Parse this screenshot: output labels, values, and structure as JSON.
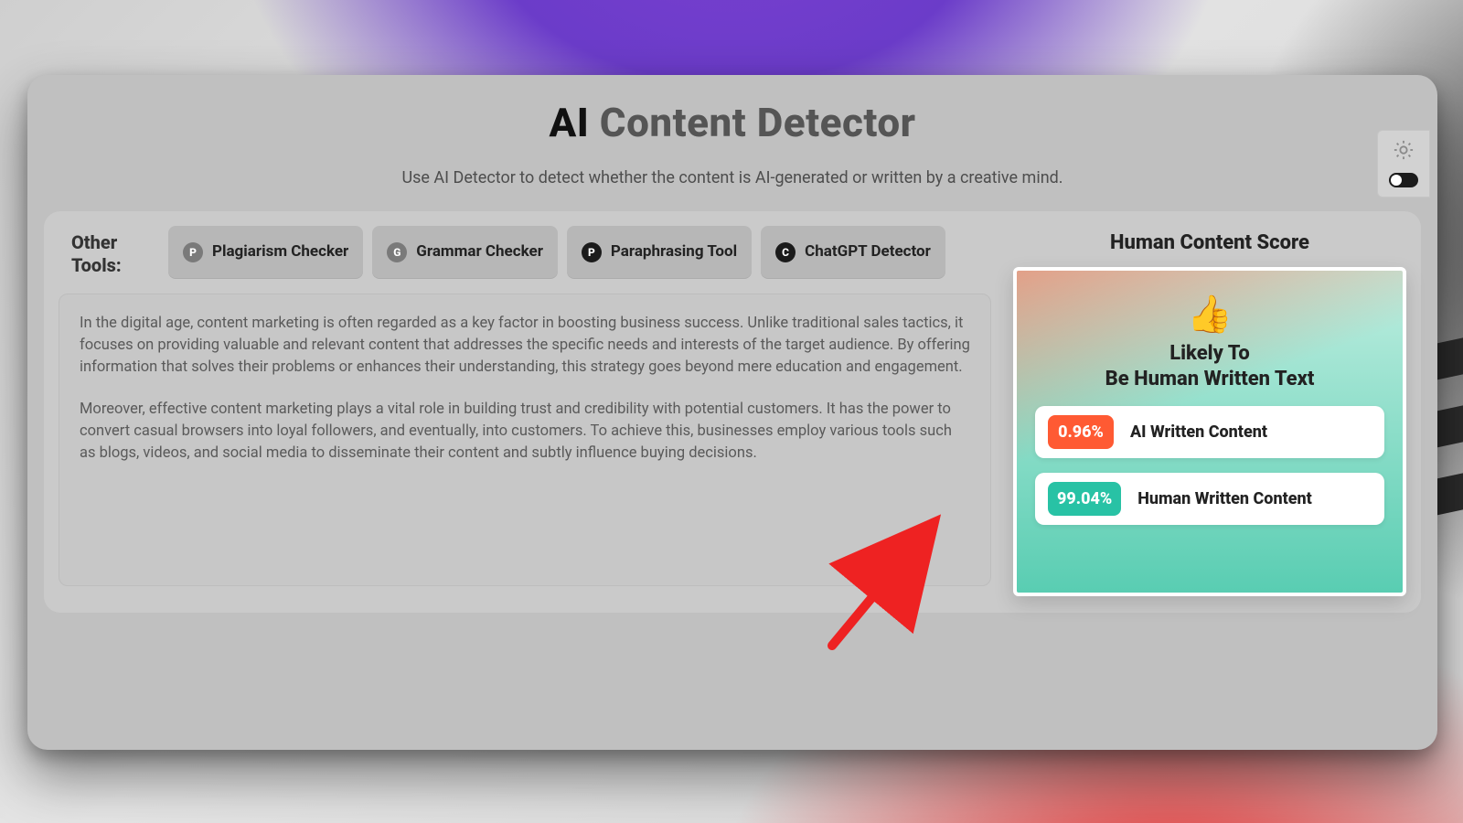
{
  "header": {
    "title_prefix": "AI",
    "title_rest": " Content Detector",
    "subtitle": "Use AI Detector to detect whether the content is AI-generated or written by a creative mind."
  },
  "theme": {
    "icon": "sun-icon",
    "mode": "dark"
  },
  "tools": {
    "label": "Other Tools:",
    "items": [
      {
        "badge": "P",
        "label": "Plagiarism Checker"
      },
      {
        "badge": "G",
        "label": "Grammar Checker"
      },
      {
        "badge": "P",
        "label": "Paraphrasing Tool"
      },
      {
        "badge": "C",
        "label": "ChatGPT Detector"
      }
    ]
  },
  "content": {
    "p1": "In the digital age, content marketing is often regarded as a key factor in boosting business success. Unlike traditional sales tactics, it focuses on providing valuable and relevant content that addresses the specific needs and interests of the target audience. By offering information that solves their problems or enhances their understanding, this strategy goes beyond mere education and engagement.",
    "p2": "Moreover, effective content marketing plays a vital role in building trust and credibility with potential customers. It has the power to convert casual browsers into loyal followers, and eventually, into customers. To achieve this, businesses employ various tools such as blogs, videos, and social media to disseminate their content and subtly influence buying decisions."
  },
  "score": {
    "title": "Human Content Score",
    "thumb": "👍",
    "verdict_line1": "Likely To",
    "verdict_line2": "Be Human Written Text",
    "ai": {
      "pct": "0.96%",
      "label": "AI Written Content",
      "color": "#ff5a33"
    },
    "human": {
      "pct": "99.04%",
      "label": "Human Written Content",
      "color": "#28c2a5"
    }
  }
}
